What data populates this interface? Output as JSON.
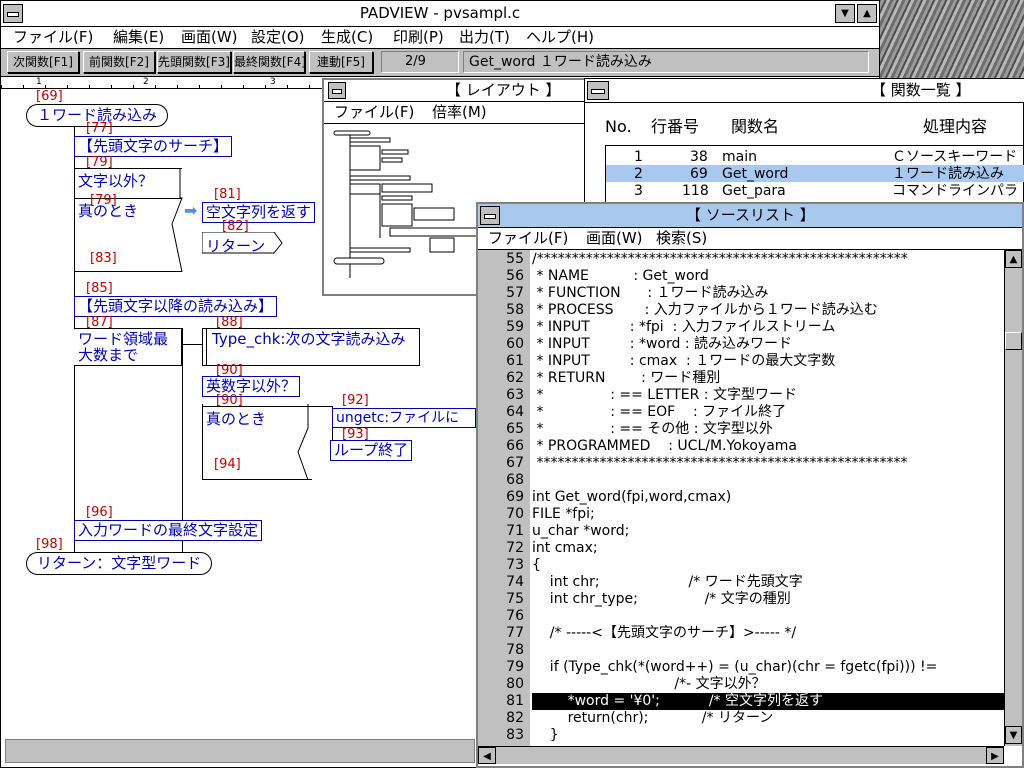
{
  "main_window": {
    "title": "PADVIEW - pvsampl.c",
    "menu": [
      "ファイル(F)",
      "編集(E)",
      "画面(W)",
      "設定(O)",
      "生成(C)",
      "印刷(P)",
      "出力(T)",
      "ヘルプ(H)"
    ],
    "toolbar": {
      "buttons": [
        "次関数[F1]",
        "前関数[F2]",
        "先頭関数[F3]",
        "最終関数[F4]",
        "連動[F5]"
      ],
      "page": "2/9",
      "function_info": "Get_word １ワード読み込み"
    },
    "ruler_marks": [
      "1",
      "2",
      "3"
    ]
  },
  "pad": {
    "numbers": [
      "[69]",
      "[77]",
      "[79]",
      "[79]",
      "[81]",
      "[82]",
      "[83]",
      "[85]",
      "[87]",
      "[88]",
      "[90]",
      "[90]",
      "[92]",
      "[93]",
      "[94]",
      "[96]",
      "[98]"
    ],
    "start": "１ワード読み込み",
    "search_head": "【先頭文字のサーチ】",
    "cond1": "文字以外？",
    "cond1_true": "真のとき",
    "empty_str": "空文字列を返す",
    "return1": "リターン",
    "read_rest": "【先頭文字以降の読み込み】",
    "loop_max": [
      "ワード領域最",
      "大数まで"
    ],
    "type_chk": "Type_chk:次の文字読み込み",
    "cond2": "英数字以外？",
    "cond2_true": "真のとき",
    "ungetc": "ungetc:ファイルに",
    "loop_end": "ループ終了",
    "last_char": "入力ワードの最終文字設定",
    "end": "リターン：文字型ワード"
  },
  "layout_window": {
    "title": "【 レイアウト 】",
    "menu": [
      "ファイル(F)",
      "倍率(M)"
    ]
  },
  "function_list": {
    "title": "【 関数一覧 】",
    "headers": [
      "No.",
      "行番号",
      "関数名",
      "処理内容"
    ],
    "rows": [
      {
        "no": "1",
        "line": "38",
        "name": "main",
        "desc": "Ｃソースキーワード"
      },
      {
        "no": "2",
        "line": "69",
        "name": "Get_word",
        "desc": "１ワード読み込み"
      },
      {
        "no": "3",
        "line": "118",
        "name": "Get_para",
        "desc": "コマンドラインパラ"
      }
    ]
  },
  "source_window": {
    "title": "【 ソースリスト 】",
    "menu": [
      "ファイル(F)",
      "画面(W)",
      "検索(S)"
    ],
    "lines": [
      {
        "n": "55",
        "code": "/*****************************************************"
      },
      {
        "n": "56",
        "code": " * NAME          : Get_word"
      },
      {
        "n": "57",
        "code": " * FUNCTION      : １ワード読み込み"
      },
      {
        "n": "58",
        "code": " * PROCESS       : 入力ファイルから１ワード読み込む"
      },
      {
        "n": "59",
        "code": " * INPUT         : *fpi  : 入力ファイルストリーム"
      },
      {
        "n": "60",
        "code": " * INPUT         : *word : 読み込みワード"
      },
      {
        "n": "61",
        "code": " * INPUT         : cmax  : １ワードの最大文字数"
      },
      {
        "n": "62",
        "code": " * RETURN        : ワード種別"
      },
      {
        "n": "63",
        "code": " *               : == LETTER : 文字型ワード"
      },
      {
        "n": "64",
        "code": " *               : == EOF    : ファイル終了"
      },
      {
        "n": "65",
        "code": " *               : == その他 : 文字型以外"
      },
      {
        "n": "66",
        "code": " * PROGRAMMED    : UCL/M.Yokoyama"
      },
      {
        "n": "67",
        "code": " *****************************************************"
      },
      {
        "n": "68",
        "code": ""
      },
      {
        "n": "69",
        "code": "int Get_word(fpi,word,cmax)"
      },
      {
        "n": "70",
        "code": "FILE *fpi;"
      },
      {
        "n": "71",
        "code": "u_char *word;"
      },
      {
        "n": "72",
        "code": "int cmax;"
      },
      {
        "n": "73",
        "code": "{"
      },
      {
        "n": "74",
        "code": "    int chr;                    /* ワード先頭文字"
      },
      {
        "n": "75",
        "code": "    int chr_type;               /* 文字の種別"
      },
      {
        "n": "76",
        "code": ""
      },
      {
        "n": "77",
        "code": "    /* -----<【先頭文字のサーチ】>----- */"
      },
      {
        "n": "78",
        "code": ""
      },
      {
        "n": "79",
        "code": "    if (Type_chk(*(word++) = (u_char)(chr = fgetc(fpi))) !="
      },
      {
        "n": "80",
        "code": "                                /*- 文字以外？"
      },
      {
        "n": "81",
        "code": "        *word = '¥0';           /* 空文字列を返す"
      },
      {
        "n": "82",
        "code": "        return(chr);            /* リターン"
      },
      {
        "n": "83",
        "code": "    }"
      }
    ],
    "highlight_line": "81"
  },
  "colors": {
    "title_active": "#a8c8f0",
    "pad_text": "#0000b0",
    "pad_number": "#c00000",
    "highlight": "#000000",
    "selected_row": "#a8c8f0"
  }
}
